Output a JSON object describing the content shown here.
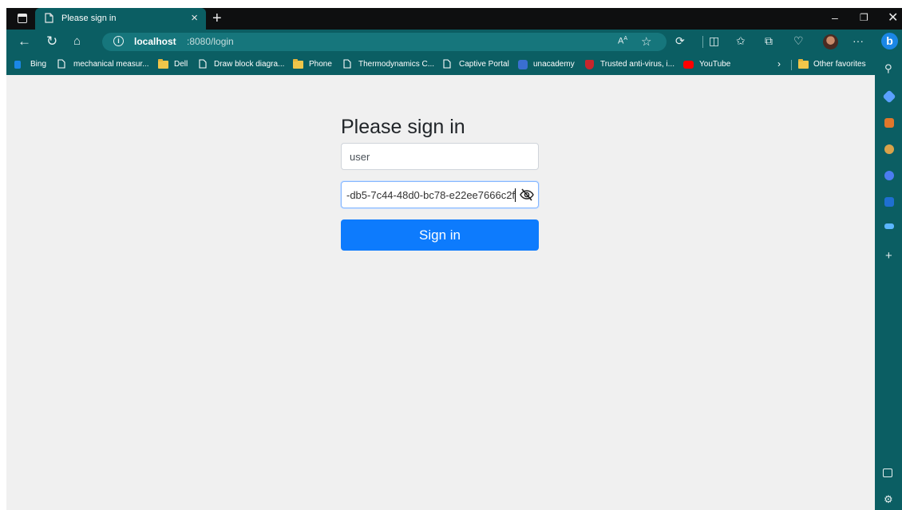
{
  "tabs": [
    {
      "title": "Please sign in"
    }
  ],
  "toolbar": {
    "url_host": "localhost",
    "url_path": ":8080/login"
  },
  "bookmarks": [
    {
      "label": "Bing",
      "icon": "bing-icon"
    },
    {
      "label": "mechanical measur...",
      "icon": "page-icon"
    },
    {
      "label": "Dell",
      "icon": "folder-icon"
    },
    {
      "label": "Draw block diagra...",
      "icon": "page-icon"
    },
    {
      "label": "Phone",
      "icon": "folder-icon"
    },
    {
      "label": "Thermodynamics C...",
      "icon": "page-icon"
    },
    {
      "label": "Captive Portal",
      "icon": "page-icon"
    },
    {
      "label": "unacademy",
      "icon": "unacademy-icon"
    },
    {
      "label": "Trusted anti-virus, i...",
      "icon": "shield-icon"
    },
    {
      "label": "YouTube",
      "icon": "youtube-icon"
    },
    {
      "label": "Other favorites",
      "icon": "folder-icon"
    }
  ],
  "form": {
    "title": "Please sign in",
    "username_value": "user",
    "password_value_visible": "-db5-7c44-48d0-bc78-e22ee7666c2f",
    "submit_label": "Sign in"
  },
  "colors": {
    "browser_chrome": "#0b5e63",
    "primary_button": "#0d7bfd",
    "page_background": "#f0f0f0"
  }
}
